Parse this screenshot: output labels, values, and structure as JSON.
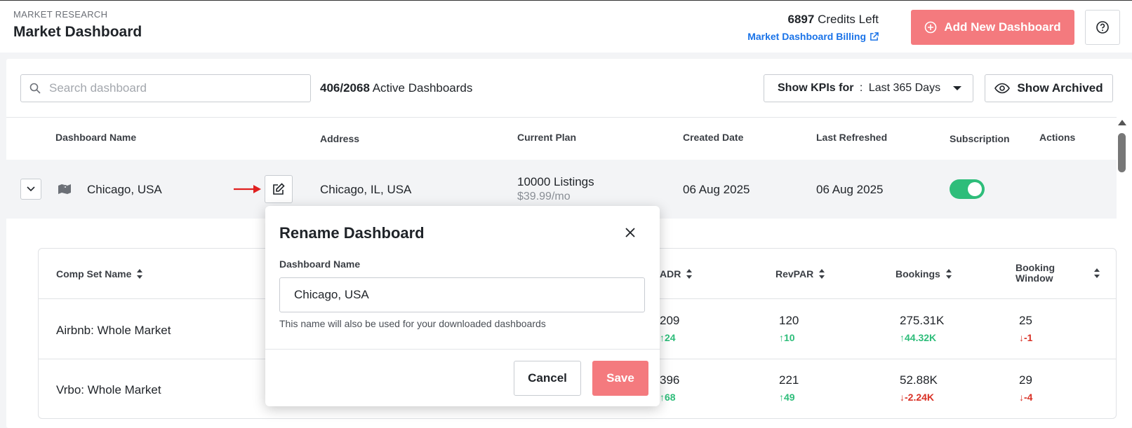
{
  "header": {
    "kicker": "MARKET RESEARCH",
    "title": "Market Dashboard",
    "credits_count": "6897",
    "credits_label": " Credits Left",
    "billing_link": "Market Dashboard Billing",
    "add_button": "Add New Dashboard"
  },
  "toolbar": {
    "search_placeholder": "Search dashboard",
    "active_count": "406/2068",
    "active_label": " Active Dashboards",
    "kpi_label": "Show KPIs for",
    "kpi_sep": " : ",
    "kpi_value": "Last 365 Days",
    "show_archived": "Show Archived"
  },
  "table": {
    "columns": [
      "Dashboard Name",
      "Address",
      "Current Plan",
      "Created Date",
      "Last Refreshed",
      "Subscription",
      "Actions"
    ],
    "row": {
      "name": "Chicago, USA",
      "address": "Chicago, IL, USA",
      "plan": "10000 Listings",
      "plan_price": "$39.99/mo",
      "created": "06 Aug 2025",
      "refreshed": "06 Aug 2025",
      "subscription_on": true
    }
  },
  "comp_sets": {
    "columns": [
      "Comp Set Name",
      "ADR",
      "RevPAR",
      "Bookings",
      "Booking Window"
    ],
    "rows": [
      {
        "name": "Airbnb: Whole Market",
        "adr": "209",
        "adr_delta": "24",
        "revpar": "120",
        "revpar_delta": "10",
        "bookings": "275.31K",
        "bookings_delta": "44.32K",
        "window": "25",
        "window_delta": "-1"
      },
      {
        "name": "Vrbo: Whole Market",
        "adr": "396",
        "adr_delta": "68",
        "revpar": "221",
        "revpar_delta": "49",
        "bookings": "52.88K",
        "bookings_delta": "-2.24K",
        "window": "29",
        "window_delta": "-4"
      }
    ]
  },
  "modal": {
    "title": "Rename Dashboard",
    "field_label": "Dashboard Name",
    "field_value": "Chicago, USA",
    "help_text": "This name will also be used for your downloaded dashboards",
    "cancel": "Cancel",
    "save": "Save"
  },
  "colors": {
    "accent": "#f47a7e",
    "link": "#1a73e8",
    "positive": "#2ebd7a",
    "negative": "#d93025"
  }
}
